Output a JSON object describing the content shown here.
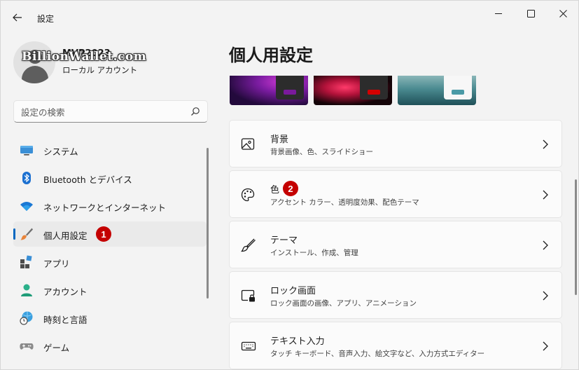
{
  "window": {
    "title": "設定"
  },
  "profile": {
    "name": "MVP2023",
    "account_type": "ローカル アカウント",
    "watermark": "BillionWallet.com"
  },
  "search": {
    "placeholder": "設定の検索"
  },
  "sidebar": {
    "items": [
      {
        "label": "システム",
        "icon": "system-monitor-icon"
      },
      {
        "label": "Bluetooth とデバイス",
        "icon": "bluetooth-icon"
      },
      {
        "label": "ネットワークとインターネット",
        "icon": "wifi-icon"
      },
      {
        "label": "個人用設定",
        "icon": "paint-brush-icon",
        "active": true,
        "badge": "1"
      },
      {
        "label": "アプリ",
        "icon": "apps-icon"
      },
      {
        "label": "アカウント",
        "icon": "person-icon"
      },
      {
        "label": "時刻と言語",
        "icon": "globe-clock-icon"
      },
      {
        "label": "ゲーム",
        "icon": "gamepad-icon"
      }
    ]
  },
  "main": {
    "title": "個人用設定",
    "themes": [
      {
        "name": "purple",
        "accent": "#7a1a9c"
      },
      {
        "name": "flower-red",
        "accent": "#d40000"
      },
      {
        "name": "lake",
        "accent": "#4a9aa6"
      }
    ],
    "cards": [
      {
        "title": "背景",
        "desc": "背景画像、色、スライドショー",
        "icon": "picture-icon"
      },
      {
        "title": "色",
        "desc": "アクセント カラー、透明度効果、配色テーマ",
        "icon": "palette-icon",
        "badge": "2"
      },
      {
        "title": "テーマ",
        "desc": "インストール、作成、管理",
        "icon": "brush-icon"
      },
      {
        "title": "ロック画面",
        "desc": "ロック画面の画像、アプリ、アニメーション",
        "icon": "lock-screen-icon"
      },
      {
        "title": "テキスト入力",
        "desc": "タッチ キーボード、音声入力、絵文字など、入力方式エディター",
        "icon": "keyboard-icon"
      }
    ]
  },
  "colors": {
    "accent": "#0067c0",
    "badge": "#c40000"
  }
}
